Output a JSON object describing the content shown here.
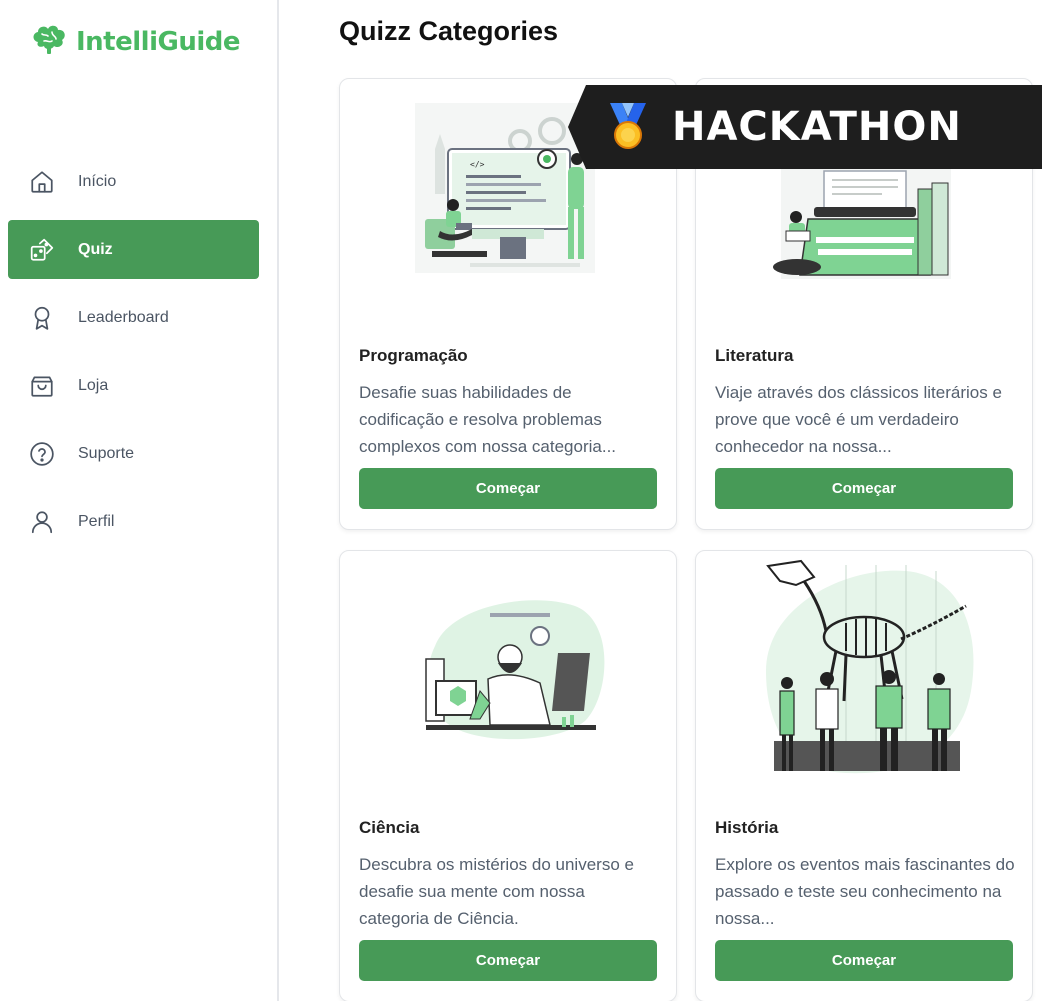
{
  "app": {
    "name": "IntelliGuide",
    "brand_color": "#4ab862",
    "accent_color": "#479a57"
  },
  "sidebar": {
    "items": [
      {
        "label": "Início",
        "icon": "home-icon",
        "active": false
      },
      {
        "label": "Quiz",
        "icon": "dice-icon",
        "active": true
      },
      {
        "label": "Leaderboard",
        "icon": "award-icon",
        "active": false
      },
      {
        "label": "Loja",
        "icon": "shopping-bag-icon",
        "active": false
      },
      {
        "label": "Suporte",
        "icon": "help-circle-icon",
        "active": false
      },
      {
        "label": "Perfil",
        "icon": "user-icon",
        "active": false
      }
    ]
  },
  "main": {
    "title": "Quizz Categories",
    "cards": [
      {
        "title": "Programação",
        "description": "Desafie suas habilidades de codificação e resolva problemas complexos com nossa categoria...",
        "button": "Começar",
        "illustration": "programming-illustration"
      },
      {
        "title": "Literatura",
        "description": "Viaje através dos clássicos literários e prove que você é um verdadeiro conhecedor na nossa...",
        "button": "Começar",
        "illustration": "typewriter-illustration"
      },
      {
        "title": "Ciência",
        "description": "Descubra os mistérios do universo e desafie sua mente com nossa categoria de Ciência.",
        "button": "Começar",
        "illustration": "scientist-illustration"
      },
      {
        "title": "História",
        "description": "Explore os eventos mais fascinantes do passado e teste seu conhecimento na nossa...",
        "button": "Começar",
        "illustration": "museum-dinosaur-illustration"
      }
    ]
  },
  "banner": {
    "text": "HACKATHON",
    "icon": "medal-icon",
    "background": "#1e1e1e"
  }
}
